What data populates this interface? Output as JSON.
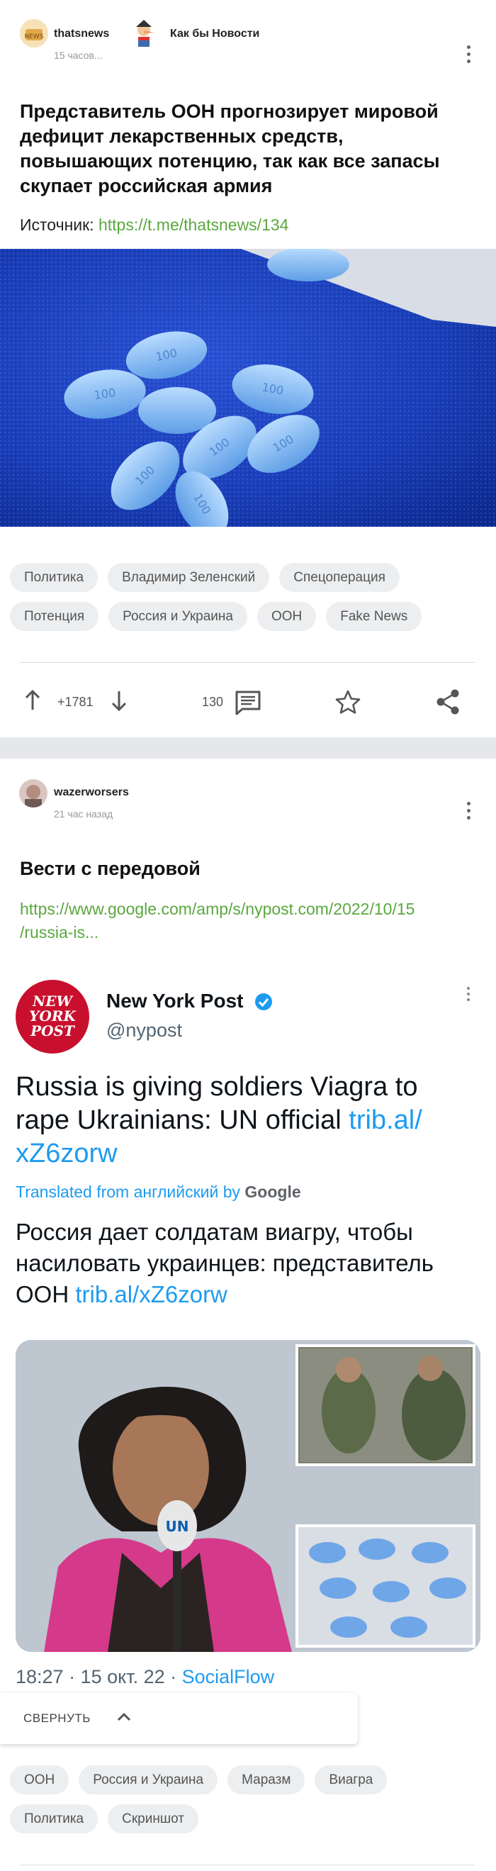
{
  "post1": {
    "author": "thatsnews",
    "community": "Как бы Новости",
    "time": "15 часов...",
    "title": "Представитель ООН прогнозирует мировой дефицит лекарственных средств, повышающих потенцию, так как все запасы скупает российская армия",
    "source_label": "Источник: ",
    "source_url": "https://t.me/thatsnews/134",
    "tags": [
      "Политика",
      "Владимир Зеленский",
      "Спецоперация",
      "Потенция",
      "Россия и Украина",
      "ООН",
      "Fake News"
    ],
    "rating": "+1781",
    "comments": "130"
  },
  "post2": {
    "author": "wazerworsers",
    "time": "21 час назад",
    "title": "Вести с передовой",
    "link_line1": "https://www.google.com/amp/s/nypost.com/2022/10/15",
    "link_line2": "/russia-is...",
    "tweet": {
      "logo_lines": [
        "NEW",
        "YORK",
        "POST"
      ],
      "name": "New York Post",
      "handle": "@nypost",
      "text_line1": "Russia is giving soldiers Viagra to",
      "text_line2a": "rape Ukrainians: UN official ",
      "text_line2_link": "trib.al/",
      "text_line3_link": "xZ6zorw",
      "translated_prefix": "Translated from английский by ",
      "translated_brand": "Google",
      "ru_line1": "Россия дает солдатам виагру, чтобы",
      "ru_line2": "насиловать украинцев: представитель",
      "ru_line3a": "ООН ",
      "ru_line3_link": "trib.al/xZ6zorw",
      "photo_sign": "UN",
      "date": "18:27 · 15 окт. 22 · ",
      "via": "SocialFlow"
    },
    "collapse_label": "СВЕРНУТЬ",
    "tags": [
      "ООН",
      "Россия и Украина",
      "Маразм",
      "Виагра",
      "Политика",
      "Скриншот"
    ]
  },
  "colors": {
    "accent_green": "#5aa83e",
    "twitter_blue": "#1d9bf0",
    "tag_bg": "#eceef0"
  },
  "icons": [
    "upvote-arrow",
    "downvote-arrow",
    "comment-icon",
    "star-icon",
    "share-icon",
    "more-icon",
    "verified-icon",
    "chevron-up-icon"
  ]
}
